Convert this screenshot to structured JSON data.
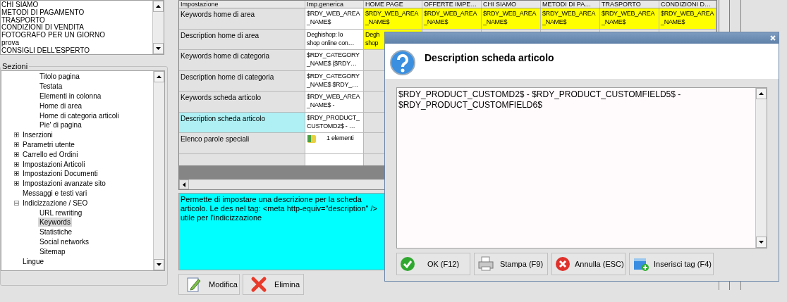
{
  "top_list": {
    "items": [
      "CHI SIAMO",
      "METODI DI PAGAMENTO",
      "TRASPORTO",
      "CONDIZIONI DI VENDITA",
      "FOTOGRAFO PER UN GIORNO",
      "prova",
      "CONSIGLI DELL'ESPERTO"
    ]
  },
  "sections": {
    "title": "Sezioni",
    "tree": [
      {
        "children": [
          {
            "label": "Titolo pagina",
            "selected": false
          },
          {
            "label": "Testata",
            "selected": false
          },
          {
            "label": "Elementi in colonna",
            "selected": false
          },
          {
            "label": "Home di area",
            "selected": false
          },
          {
            "label": "Home di categoria articoli",
            "selected": false
          },
          {
            "label": "Pie' di pagina",
            "selected": false
          }
        ]
      },
      {
        "label": "Inserzioni",
        "selected": false,
        "expanded": false
      },
      {
        "label": "Parametri utente",
        "selected": false,
        "expanded": false
      },
      {
        "label": "Carrello ed Ordini",
        "selected": false,
        "expanded": false
      },
      {
        "label": "Impostazioni Articoli",
        "selected": false,
        "expanded": false
      },
      {
        "label": "Impostazioni Documenti",
        "selected": false,
        "expanded": false
      },
      {
        "label": "Impostazioni avanzate sito",
        "selected": false,
        "expanded": false
      },
      {
        "label": "Messaggi e testi vari",
        "selected": false
      },
      {
        "label": "Indicizzazione / SEO",
        "selected": false,
        "expanded": true,
        "children": [
          {
            "label": "URL rewriting",
            "selected": false
          },
          {
            "label": "Keywords",
            "selected": true
          },
          {
            "label": "Statistiche",
            "selected": false
          },
          {
            "label": "Social networks",
            "selected": false
          },
          {
            "label": "Sitemap",
            "selected": false
          }
        ]
      },
      {
        "label": "Lingue",
        "selected": false
      }
    ]
  },
  "table": {
    "columns": [
      "Impostazione",
      "Imp.generica",
      "HOME PAGE",
      "OFFERTE IMPE…",
      "CHI SIAMO",
      "METODI DI PA…",
      "TRASPORTO",
      "CONDIZIONI D…"
    ],
    "rows": [
      {
        "selected": false,
        "cells": [
          {
            "kind": "name",
            "text": "Keywords home di area",
            "custom": false
          },
          {
            "kind": "text",
            "text": "$RDY_WEB_AREA\n_NAME$",
            "custom": false
          },
          {
            "kind": "text",
            "text": "$RDY_WEB_AREA\n_NAME$",
            "custom": true
          },
          {
            "kind": "text",
            "text": "$RDY_WEB_AREA\n_NAME$",
            "custom": true
          },
          {
            "kind": "text",
            "text": "$RDY_WEB_AREA\n_NAME$",
            "custom": true
          },
          {
            "kind": "text",
            "text": "$RDY_WEB_AREA\n_NAME$",
            "custom": true
          },
          {
            "kind": "text",
            "text": "$RDY_WEB_AREA\n_NAME$",
            "custom": true
          },
          {
            "kind": "text",
            "text": "$RDY_WEB_AREA\n_NAME$",
            "custom": true
          }
        ]
      },
      {
        "selected": false,
        "cells": [
          {
            "kind": "name",
            "text": "Description home di area",
            "custom": false
          },
          {
            "kind": "text",
            "text": "Deghishop: lo\nshop online con…",
            "custom": false
          },
          {
            "kind": "text",
            "text": "Degh\nshop",
            "custom": true
          }
        ]
      },
      {
        "selected": false,
        "cells": [
          {
            "kind": "name",
            "text": "Keywords home di categoria",
            "custom": false
          },
          {
            "kind": "text",
            "text": "$RDY_CATEGORY\n_NAME$ ($RDY…",
            "custom": false
          }
        ]
      },
      {
        "selected": false,
        "cells": [
          {
            "kind": "name",
            "text": "Description home di categoria",
            "custom": false
          },
          {
            "kind": "text",
            "text": "$RDY_CATEGORY\n_NAME$ $RDY_…",
            "custom": false
          }
        ]
      },
      {
        "selected": false,
        "cells": [
          {
            "kind": "name",
            "text": "Keywords scheda articolo",
            "custom": false
          },
          {
            "kind": "text",
            "text": "$RDY_WEB_AREA\n_NAME$ -",
            "custom": false
          }
        ]
      },
      {
        "selected": true,
        "cells": [
          {
            "kind": "name",
            "text": "Description scheda articolo",
            "custom": false
          },
          {
            "kind": "text",
            "text": "$RDY_PRODUCT_\nCUSTOMD2$ - …",
            "custom": false
          }
        ]
      },
      {
        "selected": false,
        "cells": [
          {
            "kind": "name",
            "text": "Elenco parole speciali",
            "custom": false
          },
          {
            "kind": "list",
            "text": "1 elementi",
            "custom": false
          }
        ]
      }
    ]
  },
  "help_text": "Permette di impostare una descrizione per la scheda articolo. Le des nel tag:  <meta http-equiv=\"description\" /> utile per l'indicizzazione",
  "buttons": [
    {
      "kind": "edit",
      "label": "Modifica"
    },
    {
      "kind": "delete",
      "label": "Elimina"
    }
  ],
  "dialog": {
    "title": "Description scheda articolo",
    "value": "$RDY_PRODUCT_CUSTOMD2$ - $RDY_PRODUCT_CUSTOMFIELD5$ - $RDY_PRODUCT_CUSTOMFIELD6$",
    "buttons": [
      {
        "kind": "ok",
        "label": "OK (F12)"
      },
      {
        "kind": "print",
        "label": "Stampa (F9)"
      },
      {
        "kind": "cancel",
        "label": "Annulla (ESC)"
      },
      {
        "kind": "insert",
        "label": "Inserisci tag (F4)"
      }
    ]
  }
}
